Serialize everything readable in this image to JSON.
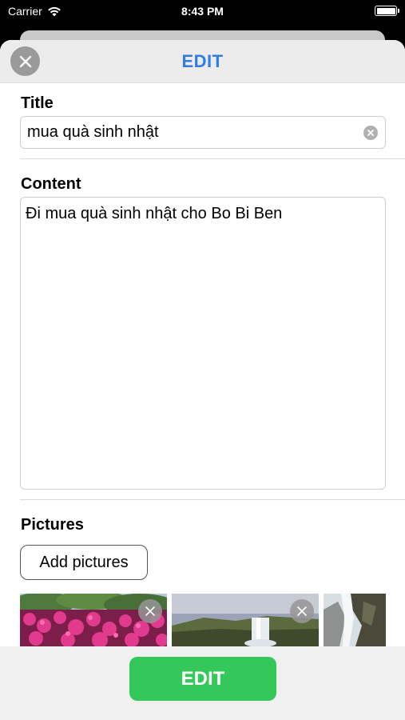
{
  "status_bar": {
    "carrier": "Carrier",
    "time": "8:43 PM"
  },
  "header": {
    "title": "EDIT",
    "close_icon": "close-icon"
  },
  "form": {
    "title_label": "Title",
    "title_value": "mua quà sinh nhật",
    "content_label": "Content",
    "content_value": "Đi mua quà sinh nhật cho Bo Bi Ben",
    "pictures_label": "Pictures",
    "add_pictures_label": "Add pictures"
  },
  "pictures": [
    {
      "subject": "pink flower bush",
      "removable": true
    },
    {
      "subject": "waterfall landscape",
      "removable": true
    },
    {
      "subject": "waterfall rocks",
      "removable": false
    }
  ],
  "bottom": {
    "edit_label": "EDIT",
    "button_color": "#34c759"
  },
  "colors": {
    "accent": "#2f7ee8",
    "success": "#34c759"
  }
}
